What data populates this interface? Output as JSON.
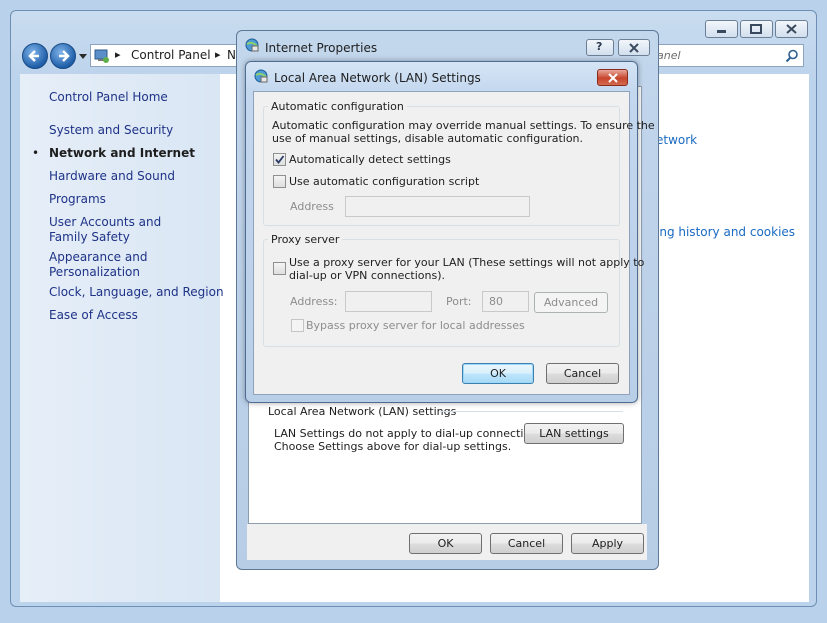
{
  "control_panel": {
    "breadcrumb": [
      "Control Panel",
      "N"
    ],
    "search_placeholder": "anel",
    "sidebar": {
      "home": "Control Panel Home",
      "items": [
        "System and Security",
        "Network and Internet",
        "Hardware and Sound",
        "Programs",
        "User Accounts and Family Safety",
        "Appearance and Personalization",
        "Clock, Language, and Region",
        "Ease of Access"
      ],
      "active_index": 1
    },
    "right_links": [
      "etwork",
      "ing history and cookies"
    ]
  },
  "internet_properties": {
    "title": "Internet Properties",
    "lan_section_title": "Local Area Network (LAN) settings",
    "lan_text": [
      "LAN Settings do not apply to dial-up connections.",
      "Choose Settings above for dial-up settings."
    ],
    "lan_settings_button": "LAN settings",
    "ok": "OK",
    "cancel": "Cancel",
    "apply": "Apply"
  },
  "lan_dialog": {
    "title": "Local Area Network (LAN) Settings",
    "auto_config": {
      "group_title": "Automatic configuration",
      "description": [
        "Automatic configuration may override manual settings.  To ensure the",
        "use of manual settings, disable automatic configuration."
      ],
      "auto_detect_label": "Automatically detect settings",
      "auto_detect_checked": true,
      "use_script_label": "Use automatic configuration script",
      "use_script_checked": false,
      "address_label": "Address",
      "address_value": ""
    },
    "proxy": {
      "group_title": "Proxy server",
      "use_proxy_label": [
        "Use a proxy server for your LAN (These settings will not apply to",
        "dial-up or VPN connections)."
      ],
      "use_proxy_checked": false,
      "address_label": "Address:",
      "address_value": "",
      "port_label": "Port:",
      "port_value": "80",
      "advanced_button": "Advanced",
      "bypass_label": "Bypass proxy server for local addresses",
      "bypass_checked": false
    },
    "ok": "OK",
    "cancel": "Cancel"
  }
}
